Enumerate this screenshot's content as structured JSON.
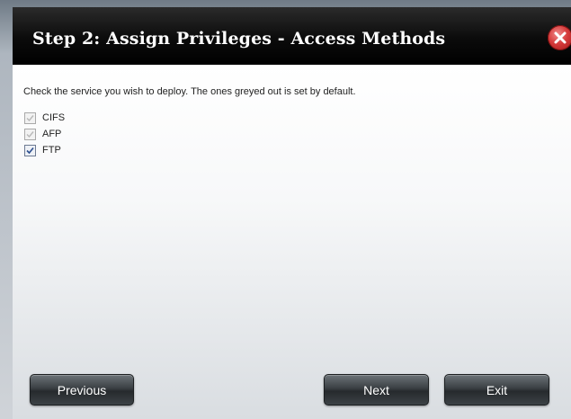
{
  "dialog": {
    "title": "Step 2: Assign Privileges - Access Methods",
    "instructions": "Check the service you wish to deploy. The ones greyed out is set by default.",
    "services": [
      {
        "label": "CIFS",
        "checked": true,
        "disabled": true
      },
      {
        "label": "AFP",
        "checked": true,
        "disabled": true
      },
      {
        "label": "FTP",
        "checked": true,
        "disabled": false
      }
    ],
    "buttons": {
      "previous": "Previous",
      "next": "Next",
      "exit": "Exit"
    }
  },
  "colors": {
    "title_bar": "#000000",
    "close_button": "#d53a3a",
    "button_face": "#3a3f43",
    "disabled_check": "#b8b8b8",
    "enabled_check": "#2d4f8f"
  },
  "icons": {
    "close": "close-x-icon",
    "check": "checkmark-icon"
  }
}
